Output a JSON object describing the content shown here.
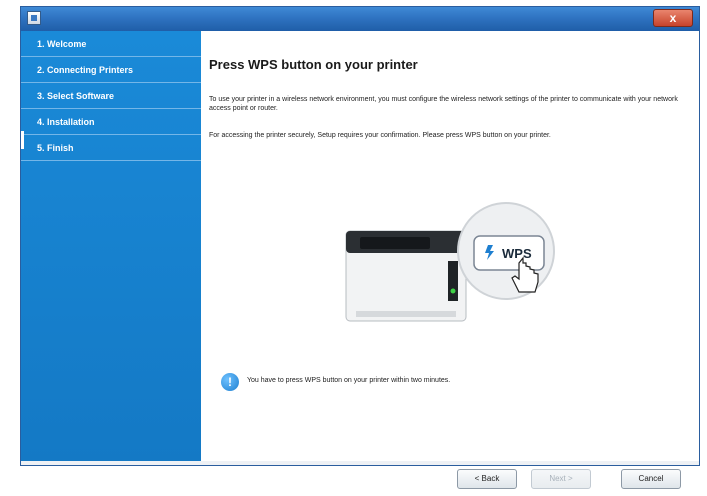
{
  "window": {
    "close_label": "x"
  },
  "sidebar": {
    "items": [
      {
        "label": "1. Welcome"
      },
      {
        "label": "2. Connecting Printers"
      },
      {
        "label": "3. Select Software"
      },
      {
        "label": "4. Installation"
      },
      {
        "label": "5. Finish"
      }
    ]
  },
  "main": {
    "title": "Press WPS button on your printer",
    "para1": "To use your printer in a wireless network environment, you must configure the wireless network settings of the printer to communicate with your network access point or router.",
    "para2": "For accessing the printer securely, Setup requires your confirmation. Please press WPS button on your printer.",
    "wps_label": "WPS",
    "info_text": "You have to press WPS button on your printer within two minutes."
  },
  "footer": {
    "back_label": "< Back",
    "next_label": "Next >",
    "cancel_label": "Cancel"
  },
  "colors": {
    "sidebar": "#1479c5",
    "accent": "#2f73c1"
  },
  "icons": [
    "app-icon",
    "close-icon",
    "printer-icon",
    "wps-icon",
    "hand-cursor-icon",
    "info-icon"
  ]
}
